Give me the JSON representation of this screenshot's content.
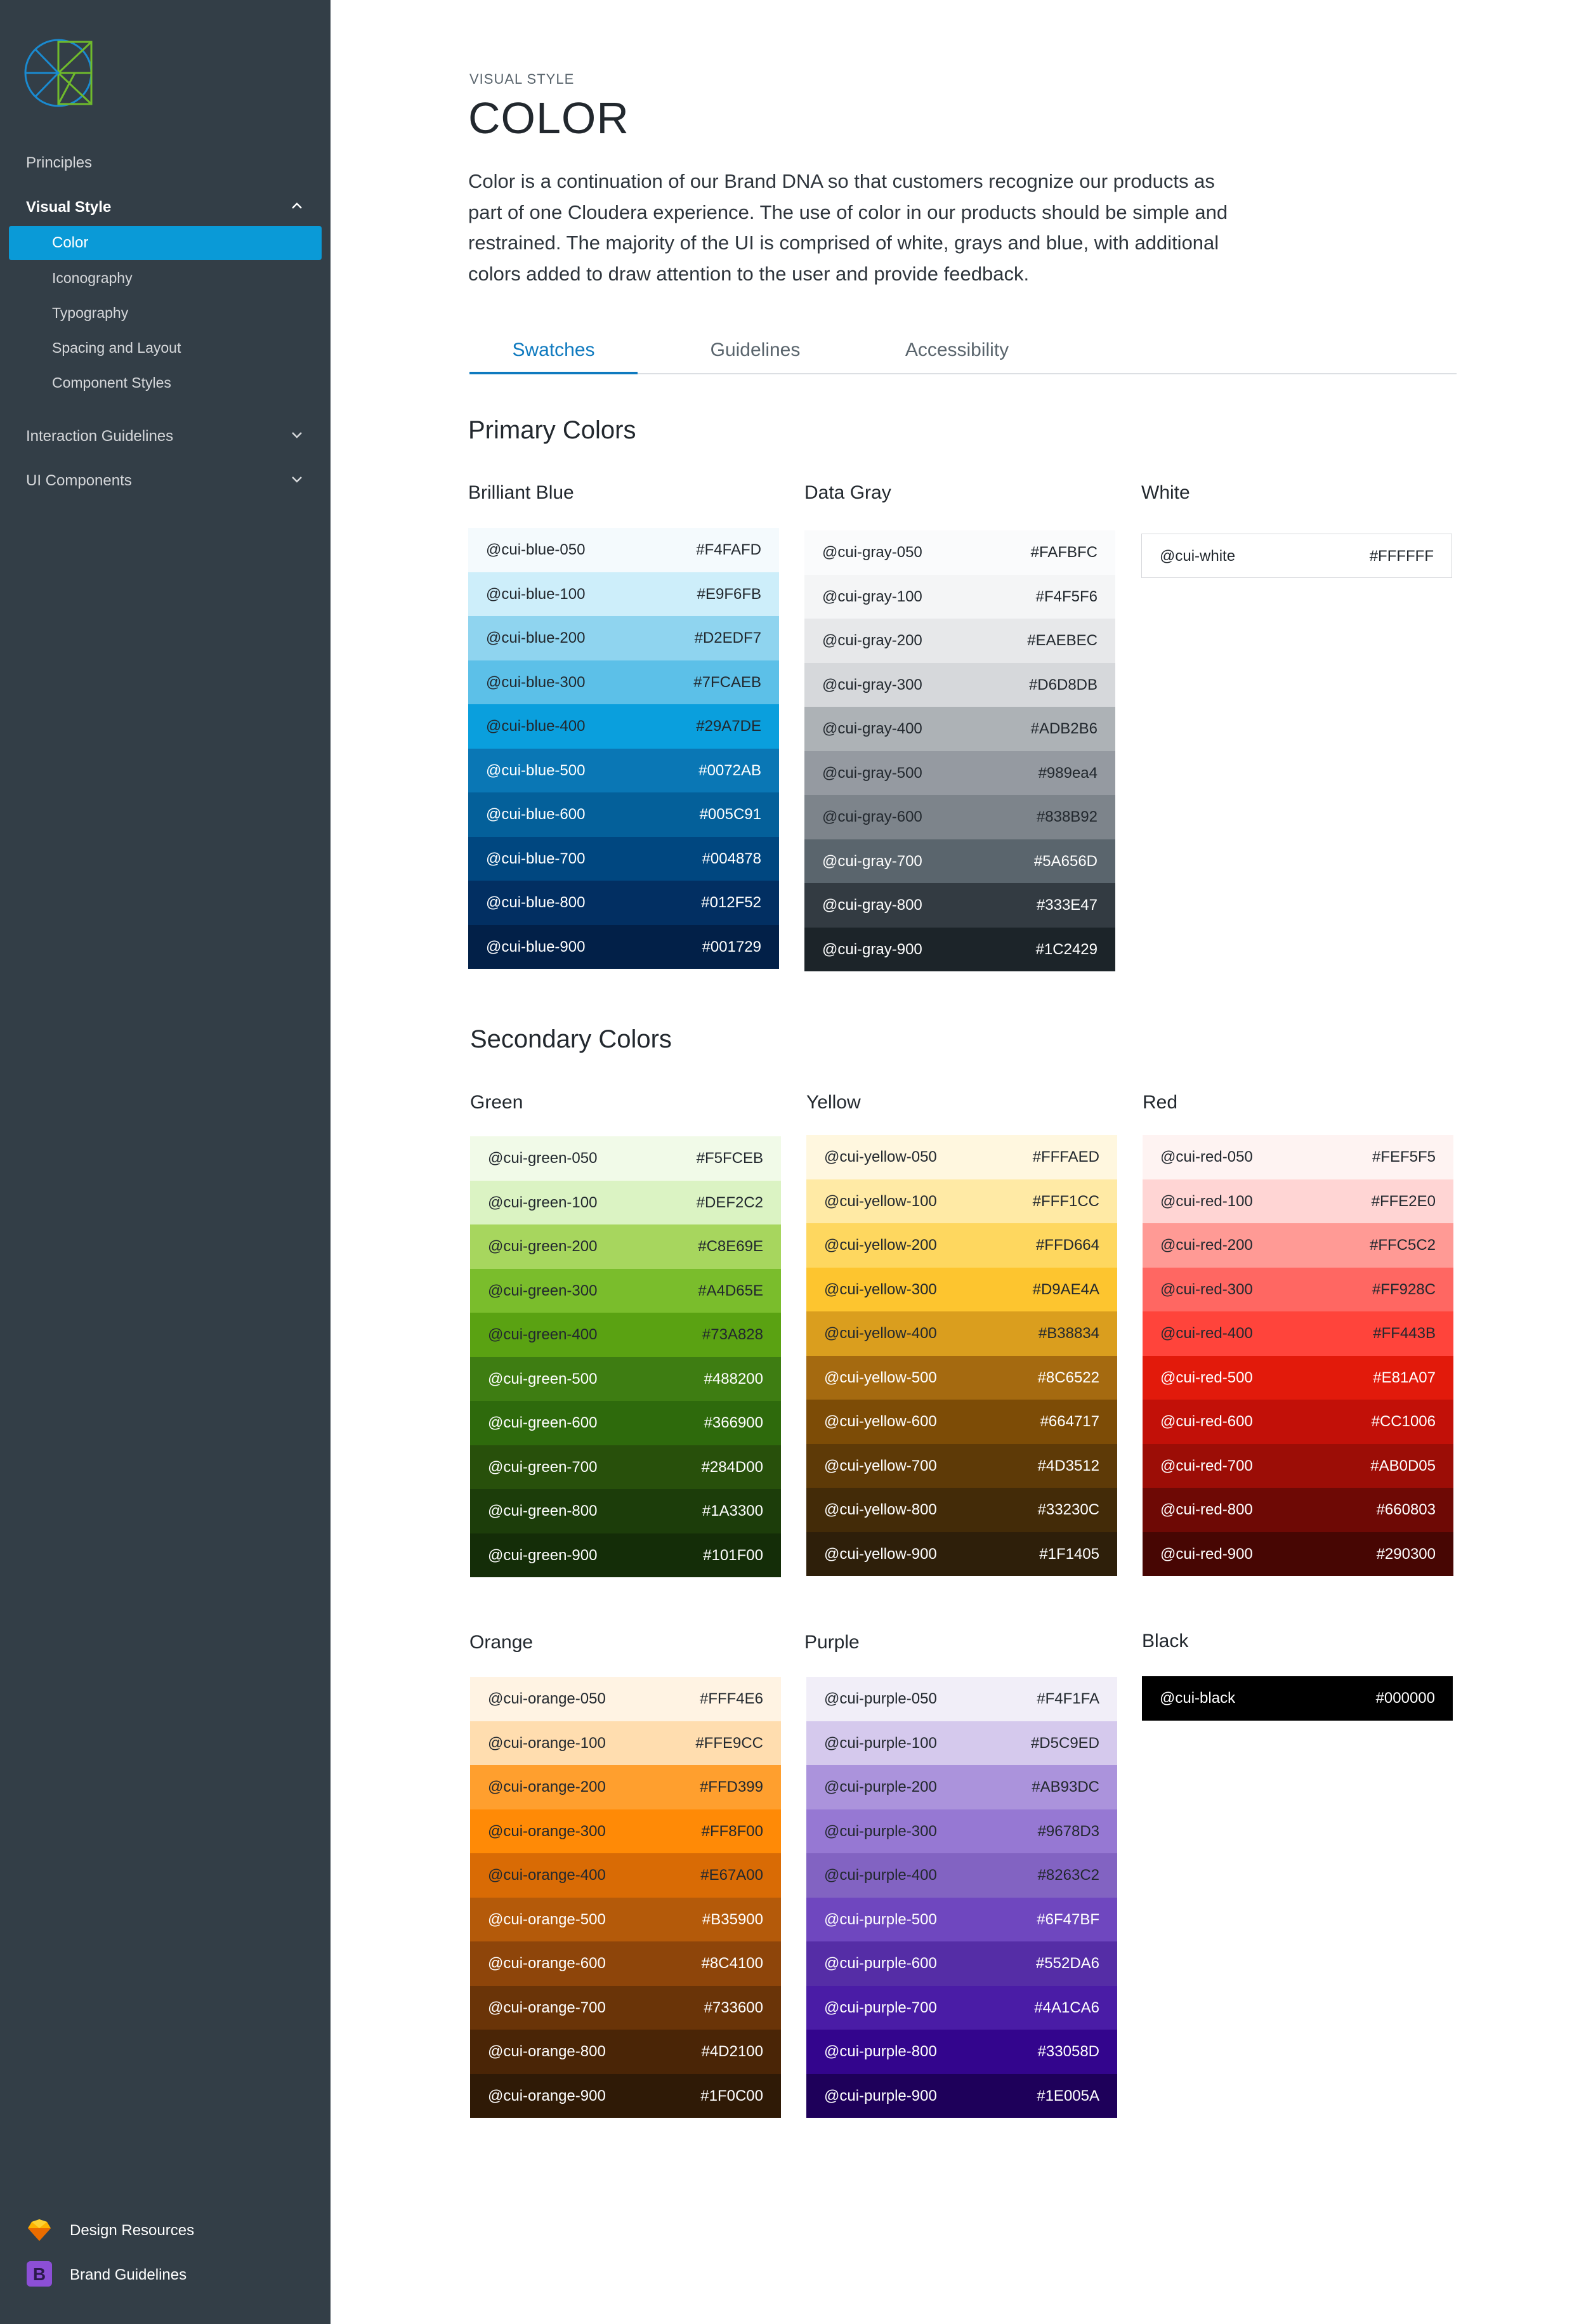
{
  "sidebar": {
    "nav": [
      {
        "label": "Principles"
      },
      {
        "label": "Visual Style"
      },
      {
        "label": "Interaction Guidelines"
      },
      {
        "label": "UI Components"
      }
    ],
    "visual_style_items": [
      "Color",
      "Iconography",
      "Typography",
      "Spacing and Layout",
      "Component Styles"
    ],
    "resources": [
      {
        "label": "Design Resources",
        "icon": "sketch-diamond-icon"
      },
      {
        "label": "Brand Guidelines",
        "icon": "brand-b-icon"
      }
    ]
  },
  "header": {
    "eyebrow": "VISUAL STYLE",
    "title": "COLOR",
    "intro": "Color is a continuation of our Brand DNA so that customers recognize our products as part of one Cloudera experience. The use of color in our products should be simple and restrained. The majority of the UI is comprised of white, grays and blue, with additional colors added to draw attention to the user and provide feedback."
  },
  "tabs": [
    {
      "label": "Swatches"
    },
    {
      "label": "Guidelines"
    },
    {
      "label": "Accessibility"
    }
  ],
  "sections": {
    "primary": "Primary Colors",
    "secondary": "Secondary Colors"
  },
  "groups": {
    "blue": {
      "title": "Brilliant Blue",
      "swatches": [
        {
          "name": "@cui-blue-050",
          "hex": "#F4FAFD",
          "bg": "#F4FAFD",
          "fg": "#22282e"
        },
        {
          "name": "@cui-blue-100",
          "hex": "#E9F6FB",
          "bg": "#CDEEFA",
          "fg": "#22282e"
        },
        {
          "name": "@cui-blue-200",
          "hex": "#D2EDF7",
          "bg": "#8FD4EF",
          "fg": "#22282e"
        },
        {
          "name": "@cui-blue-300",
          "hex": "#7FCAEB",
          "bg": "#5CC0E8",
          "fg": "#22282e"
        },
        {
          "name": "@cui-blue-400",
          "hex": "#29A7DE",
          "bg": "#0A9FDD",
          "fg": "#22282e"
        },
        {
          "name": "@cui-blue-500",
          "hex": "#0072AB",
          "bg": "#0A77B5",
          "fg": "#ffffff"
        },
        {
          "name": "@cui-blue-600",
          "hex": "#005C91",
          "bg": "#04609A",
          "fg": "#ffffff"
        },
        {
          "name": "@cui-blue-700",
          "hex": "#004878",
          "bg": "#004780",
          "fg": "#ffffff"
        },
        {
          "name": "@cui-blue-800",
          "hex": "#012F52",
          "bg": "#022F62",
          "fg": "#ffffff"
        },
        {
          "name": "@cui-blue-900",
          "hex": "#001729",
          "bg": "#022048",
          "fg": "#ffffff"
        }
      ]
    },
    "gray": {
      "title": "Data Gray",
      "swatches": [
        {
          "name": "@cui-gray-050",
          "hex": "#FAFBFC",
          "bg": "#FAFBFC",
          "fg": "#22282e"
        },
        {
          "name": "@cui-gray-100",
          "hex": "#F4F5F6",
          "bg": "#F4F5F6",
          "fg": "#22282e"
        },
        {
          "name": "@cui-gray-200",
          "hex": "#EAEBEC",
          "bg": "#E7E8EA",
          "fg": "#22282e"
        },
        {
          "name": "@cui-gray-300",
          "hex": "#D6D8DB",
          "bg": "#D6D8DB",
          "fg": "#22282e"
        },
        {
          "name": "@cui-gray-400",
          "hex": "#ADB2B6",
          "bg": "#ADB2B6",
          "fg": "#22282e"
        },
        {
          "name": "@cui-gray-500",
          "hex": "#989ea4",
          "bg": "#959AA1",
          "fg": "#22282e"
        },
        {
          "name": "@cui-gray-600",
          "hex": "#838B92",
          "bg": "#7D848B",
          "fg": "#22282e"
        },
        {
          "name": "@cui-gray-700",
          "hex": "#5A656D",
          "bg": "#5A656D",
          "fg": "#ffffff"
        },
        {
          "name": "@cui-gray-800",
          "hex": "#333E47",
          "bg": "#333B42",
          "fg": "#ffffff"
        },
        {
          "name": "@cui-gray-900",
          "hex": "#1C2429",
          "bg": "#1C2429",
          "fg": "#ffffff"
        }
      ]
    },
    "white": {
      "title": "White",
      "swatch": {
        "name": "@cui-white",
        "hex": "#FFFFFF",
        "bg": "#FFFFFF",
        "fg": "#22282e"
      }
    },
    "green": {
      "title": "Green",
      "swatches": [
        {
          "name": "@cui-green-050",
          "hex": "#F5FCEB",
          "bg": "#F1FAE8",
          "fg": "#22282e"
        },
        {
          "name": "@cui-green-100",
          "hex": "#DEF2C2",
          "bg": "#DBF3C3",
          "fg": "#22282e"
        },
        {
          "name": "@cui-green-200",
          "hex": "#C8E69E",
          "bg": "#A7D65E",
          "fg": "#22282e"
        },
        {
          "name": "@cui-green-300",
          "hex": "#A4D65E",
          "bg": "#7ABD2C",
          "fg": "#22282e"
        },
        {
          "name": "@cui-green-400",
          "hex": "#73A828",
          "bg": "#5AA212",
          "fg": "#22282e"
        },
        {
          "name": "@cui-green-500",
          "hex": "#488200",
          "bg": "#3E7D12",
          "fg": "#ffffff"
        },
        {
          "name": "@cui-green-600",
          "hex": "#366900",
          "bg": "#2E6A0C",
          "fg": "#ffffff"
        },
        {
          "name": "@cui-green-700",
          "hex": "#284D00",
          "bg": "#28500B",
          "fg": "#ffffff"
        },
        {
          "name": "@cui-green-800",
          "hex": "#1A3300",
          "bg": "#1C3D0A",
          "fg": "#ffffff"
        },
        {
          "name": "@cui-green-900",
          "hex": "#101F00",
          "bg": "#142D08",
          "fg": "#ffffff"
        }
      ]
    },
    "yellow": {
      "title": "Yellow",
      "swatches": [
        {
          "name": "@cui-yellow-050",
          "hex": "#FFFAED",
          "bg": "#FFF7DF",
          "fg": "#22282e"
        },
        {
          "name": "@cui-yellow-100",
          "hex": "#FFF1CC",
          "bg": "#FFEAA5",
          "fg": "#22282e"
        },
        {
          "name": "@cui-yellow-200",
          "hex": "#FFD664",
          "bg": "#FED75F",
          "fg": "#22282e"
        },
        {
          "name": "@cui-yellow-300",
          "hex": "#D9AE4A",
          "bg": "#FDC52F",
          "fg": "#22282e"
        },
        {
          "name": "@cui-yellow-400",
          "hex": "#B38834",
          "bg": "#DA9E1E",
          "fg": "#22282e"
        },
        {
          "name": "@cui-yellow-500",
          "hex": "#8C6522",
          "bg": "#A56A10",
          "fg": "#ffffff"
        },
        {
          "name": "@cui-yellow-600",
          "hex": "#664717",
          "bg": "#7D4C06",
          "fg": "#ffffff"
        },
        {
          "name": "@cui-yellow-700",
          "hex": "#4D3512",
          "bg": "#5E3A07",
          "fg": "#ffffff"
        },
        {
          "name": "@cui-yellow-800",
          "hex": "#33230C",
          "bg": "#432B08",
          "fg": "#ffffff"
        },
        {
          "name": "@cui-yellow-900",
          "hex": "#1F1405",
          "bg": "#2E1F0A",
          "fg": "#ffffff"
        }
      ]
    },
    "red": {
      "title": "Red",
      "swatches": [
        {
          "name": "@cui-red-050",
          "hex": "#FEF5F5",
          "bg": "#FEF3F2",
          "fg": "#22282e"
        },
        {
          "name": "@cui-red-100",
          "hex": "#FFE2E0",
          "bg": "#FFD5D4",
          "fg": "#22282e"
        },
        {
          "name": "@cui-red-200",
          "hex": "#FFC5C2",
          "bg": "#FF9A95",
          "fg": "#22282e"
        },
        {
          "name": "@cui-red-300",
          "hex": "#FF928C",
          "bg": "#FF6762",
          "fg": "#22282e"
        },
        {
          "name": "@cui-red-400",
          "hex": "#FF443B",
          "bg": "#FF443B",
          "fg": "#22282e"
        },
        {
          "name": "@cui-red-500",
          "hex": "#E81A07",
          "bg": "#E21A0B",
          "fg": "#ffffff"
        },
        {
          "name": "@cui-red-600",
          "hex": "#CC1006",
          "bg": "#C21008",
          "fg": "#ffffff"
        },
        {
          "name": "@cui-red-700",
          "hex": "#AB0D05",
          "bg": "#9C0D06",
          "fg": "#ffffff"
        },
        {
          "name": "@cui-red-800",
          "hex": "#660803",
          "bg": "#6E0905",
          "fg": "#ffffff"
        },
        {
          "name": "@cui-red-900",
          "hex": "#290300",
          "bg": "#470603",
          "fg": "#ffffff"
        }
      ]
    },
    "orange": {
      "title": "Orange",
      "swatches": [
        {
          "name": "@cui-orange-050",
          "hex": "#FFF4E6",
          "bg": "#FFF3E3",
          "fg": "#22282e"
        },
        {
          "name": "@cui-orange-100",
          "hex": "#FFE9CC",
          "bg": "#FFDDAF",
          "fg": "#22282e"
        },
        {
          "name": "@cui-orange-200",
          "hex": "#FFD399",
          "bg": "#FF9F2E",
          "fg": "#22282e"
        },
        {
          "name": "@cui-orange-300",
          "hex": "#FF8F00",
          "bg": "#FF8A06",
          "fg": "#22282e"
        },
        {
          "name": "@cui-orange-400",
          "hex": "#E67A00",
          "bg": "#D96B05",
          "fg": "#22282e"
        },
        {
          "name": "@cui-orange-500",
          "hex": "#B35900",
          "bg": "#B45A0A",
          "fg": "#ffffff"
        },
        {
          "name": "@cui-orange-600",
          "hex": "#8C4100",
          "bg": "#8E450A",
          "fg": "#ffffff"
        },
        {
          "name": "@cui-orange-700",
          "hex": "#733600",
          "bg": "#6A3408",
          "fg": "#ffffff"
        },
        {
          "name": "@cui-orange-800",
          "hex": "#4D2100",
          "bg": "#4A2506",
          "fg": "#ffffff"
        },
        {
          "name": "@cui-orange-900",
          "hex": "#1F0C00",
          "bg": "#2F1A06",
          "fg": "#ffffff"
        }
      ]
    },
    "purple": {
      "title": "Purple",
      "swatches": [
        {
          "name": "@cui-purple-050",
          "hex": "#F4F1FA",
          "bg": "#F1EEF8",
          "fg": "#22282e"
        },
        {
          "name": "@cui-purple-100",
          "hex": "#D5C9ED",
          "bg": "#D5C9ED",
          "fg": "#22282e"
        },
        {
          "name": "@cui-purple-200",
          "hex": "#AB93DC",
          "bg": "#AB93DC",
          "fg": "#22282e"
        },
        {
          "name": "@cui-purple-300",
          "hex": "#9678D3",
          "bg": "#9678D3",
          "fg": "#22282e"
        },
        {
          "name": "@cui-purple-400",
          "hex": "#8263C2",
          "bg": "#8263C2",
          "fg": "#22282e"
        },
        {
          "name": "@cui-purple-500",
          "hex": "#6F47BF",
          "bg": "#6F47BF",
          "fg": "#ffffff"
        },
        {
          "name": "@cui-purple-600",
          "hex": "#552DA6",
          "bg": "#552DA6",
          "fg": "#ffffff"
        },
        {
          "name": "@cui-purple-700",
          "hex": "#4A1CA6",
          "bg": "#4A1CA6",
          "fg": "#ffffff"
        },
        {
          "name": "@cui-purple-800",
          "hex": "#33058D",
          "bg": "#33058D",
          "fg": "#ffffff"
        },
        {
          "name": "@cui-purple-900",
          "hex": "#1E005A",
          "bg": "#1E005A",
          "fg": "#ffffff"
        }
      ]
    },
    "black": {
      "title": "Black",
      "swatch": {
        "name": "@cui-black",
        "hex": "#000000",
        "bg": "#000000",
        "fg": "#ffffff"
      }
    }
  }
}
